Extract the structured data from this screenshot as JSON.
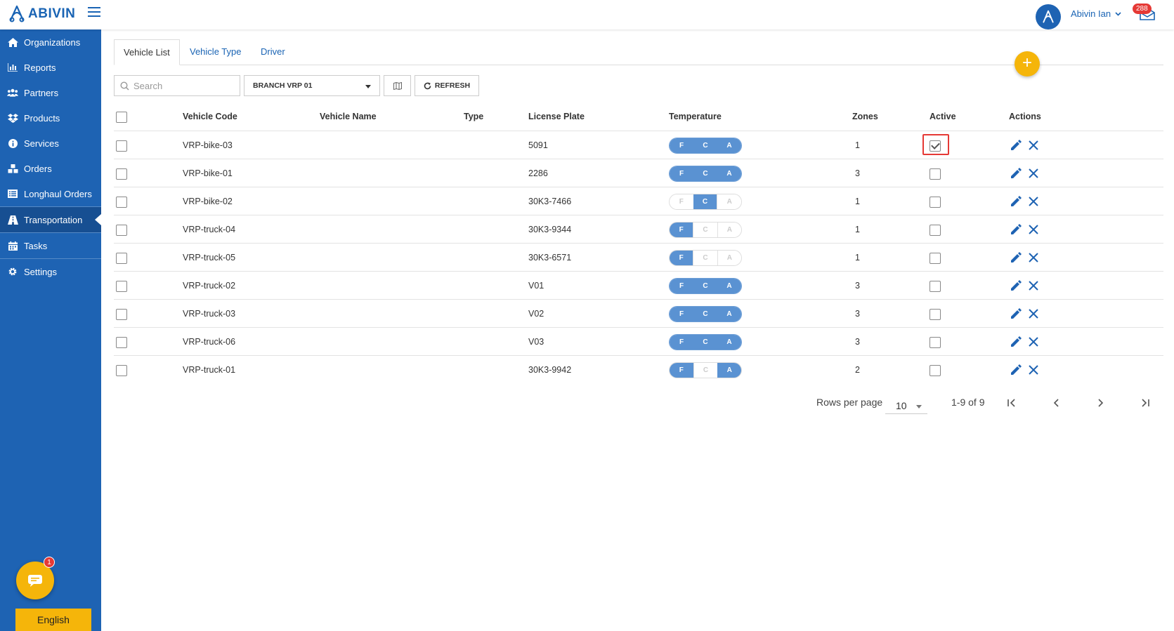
{
  "header": {
    "logo_text": "ABIVIN",
    "user_name": "Abivin Ian",
    "mail_badge": "288"
  },
  "sidebar": {
    "items": [
      {
        "label": "Organizations",
        "icon": "home-icon"
      },
      {
        "label": "Reports",
        "icon": "bar-chart-icon"
      },
      {
        "label": "Partners",
        "icon": "users-icon"
      },
      {
        "label": "Products",
        "icon": "dropbox-icon"
      },
      {
        "label": "Services",
        "icon": "info-icon"
      },
      {
        "label": "Orders",
        "icon": "cubes-icon"
      },
      {
        "label": "Longhaul Orders",
        "icon": "list-icon"
      },
      {
        "label": "Transportation",
        "icon": "road-icon",
        "active": true
      },
      {
        "label": "Tasks",
        "icon": "calendar-icon"
      },
      {
        "label": "Settings",
        "icon": "gear-icon"
      }
    ],
    "chat_badge": "1",
    "language": "English"
  },
  "tabs": [
    {
      "label": "Vehicle List",
      "active": true
    },
    {
      "label": "Vehicle Type"
    },
    {
      "label": "Driver"
    }
  ],
  "toolbar": {
    "search_placeholder": "Search",
    "branch": "BRANCH VRP 01",
    "refresh_label": "REFRESH",
    "add_label": "+"
  },
  "table": {
    "columns": [
      "Vehicle Code",
      "Vehicle Name",
      "Type",
      "License Plate",
      "Temperature",
      "Zones",
      "Active",
      "Actions"
    ],
    "rows": [
      {
        "code": "VRP-bike-03",
        "name": "",
        "type": "",
        "plate": "5091",
        "temp": [
          true,
          true,
          true
        ],
        "zones": "1",
        "active": true
      },
      {
        "code": "VRP-bike-01",
        "name": "",
        "type": "",
        "plate": "2286",
        "temp": [
          true,
          true,
          true
        ],
        "zones": "3",
        "active": false
      },
      {
        "code": "VRP-bike-02",
        "name": "",
        "type": "",
        "plate": "30K3-7466",
        "temp": [
          false,
          true,
          false
        ],
        "zones": "1",
        "active": false
      },
      {
        "code": "VRP-truck-04",
        "name": "",
        "type": "",
        "plate": "30K3-9344",
        "temp": [
          true,
          false,
          false
        ],
        "zones": "1",
        "active": false
      },
      {
        "code": "VRP-truck-05",
        "name": "",
        "type": "",
        "plate": "30K3-6571",
        "temp": [
          true,
          false,
          false
        ],
        "zones": "1",
        "active": false
      },
      {
        "code": "VRP-truck-02",
        "name": "",
        "type": "",
        "plate": "V01",
        "temp": [
          true,
          true,
          true
        ],
        "zones": "3",
        "active": false
      },
      {
        "code": "VRP-truck-03",
        "name": "",
        "type": "",
        "plate": "V02",
        "temp": [
          true,
          true,
          true
        ],
        "zones": "3",
        "active": false
      },
      {
        "code": "VRP-truck-06",
        "name": "",
        "type": "",
        "plate": "V03",
        "temp": [
          true,
          true,
          true
        ],
        "zones": "3",
        "active": false
      },
      {
        "code": "VRP-truck-01",
        "name": "",
        "type": "",
        "plate": "30K3-9942",
        "temp": [
          true,
          false,
          true
        ],
        "zones": "2",
        "active": false
      }
    ],
    "temp_labels": [
      "F",
      "C",
      "A"
    ]
  },
  "pagination": {
    "rows_per_page_label": "Rows per page",
    "rows_per_page": "10",
    "range": "1-9 of 9"
  },
  "colors": {
    "primary": "#1e63b3",
    "accent": "#f5b50a",
    "temp_on": "#5a92d2",
    "badge": "#e53935"
  }
}
